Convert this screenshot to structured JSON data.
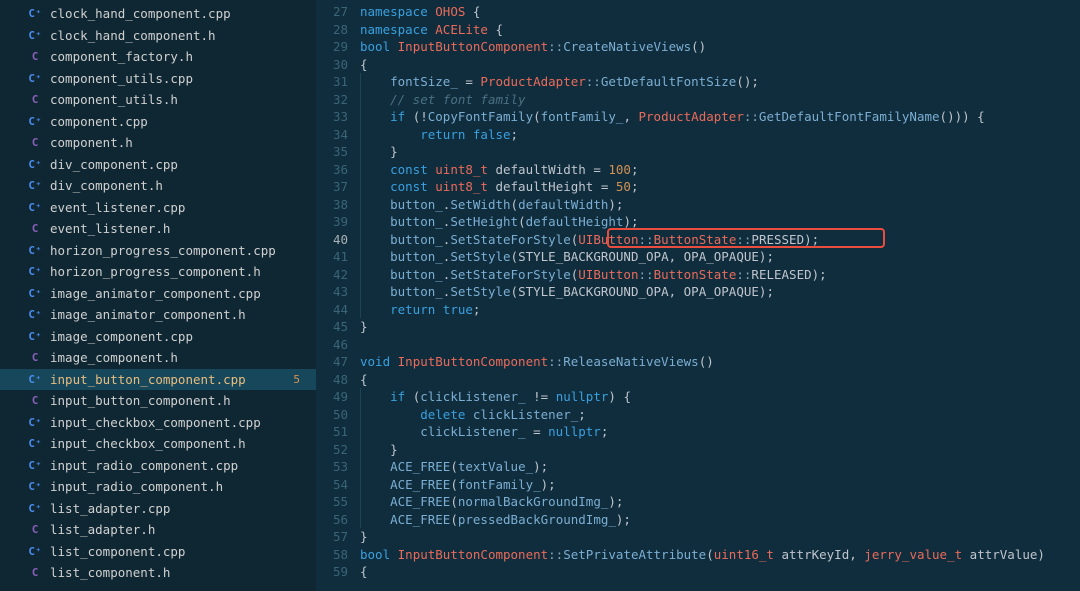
{
  "sidebar": {
    "files": [
      {
        "name": "clock_hand_component.cpp",
        "icon": "cpp"
      },
      {
        "name": "clock_hand_component.h",
        "icon": "cpp"
      },
      {
        "name": "component_factory.h",
        "icon": "h"
      },
      {
        "name": "component_utils.cpp",
        "icon": "cpp"
      },
      {
        "name": "component_utils.h",
        "icon": "h"
      },
      {
        "name": "component.cpp",
        "icon": "cpp"
      },
      {
        "name": "component.h",
        "icon": "h"
      },
      {
        "name": "div_component.cpp",
        "icon": "cpp"
      },
      {
        "name": "div_component.h",
        "icon": "cpp"
      },
      {
        "name": "event_listener.cpp",
        "icon": "cpp"
      },
      {
        "name": "event_listener.h",
        "icon": "h"
      },
      {
        "name": "horizon_progress_component.cpp",
        "icon": "cpp"
      },
      {
        "name": "horizon_progress_component.h",
        "icon": "cpp"
      },
      {
        "name": "image_animator_component.cpp",
        "icon": "cpp"
      },
      {
        "name": "image_animator_component.h",
        "icon": "cpp"
      },
      {
        "name": "image_component.cpp",
        "icon": "cpp"
      },
      {
        "name": "image_component.h",
        "icon": "h"
      },
      {
        "name": "input_button_component.cpp",
        "icon": "cpp",
        "active": true,
        "badge": "5"
      },
      {
        "name": "input_button_component.h",
        "icon": "h"
      },
      {
        "name": "input_checkbox_component.cpp",
        "icon": "cpp"
      },
      {
        "name": "input_checkbox_component.h",
        "icon": "cpp"
      },
      {
        "name": "input_radio_component.cpp",
        "icon": "cpp"
      },
      {
        "name": "input_radio_component.h",
        "icon": "cpp"
      },
      {
        "name": "list_adapter.cpp",
        "icon": "cpp"
      },
      {
        "name": "list_adapter.h",
        "icon": "h"
      },
      {
        "name": "list_component.cpp",
        "icon": "cpp"
      },
      {
        "name": "list_component.h",
        "icon": "h"
      }
    ]
  },
  "editor": {
    "startLine": 27,
    "currentLine": 40,
    "highlight": {
      "line": 40,
      "startCol": 27,
      "endCol": 59
    },
    "lines": [
      {
        "n": 27,
        "seg": [
          [
            "kw",
            "namespace "
          ],
          [
            "cls",
            "OHOS"
          ],
          [
            "plain",
            " {"
          ]
        ]
      },
      {
        "n": 28,
        "seg": [
          [
            "kw",
            "namespace "
          ],
          [
            "cls",
            "ACELite"
          ],
          [
            "plain",
            " {"
          ]
        ]
      },
      {
        "n": 29,
        "seg": [
          [
            "kw",
            "bool "
          ],
          [
            "cls",
            "InputButtonComponent"
          ],
          [
            "op",
            "::"
          ],
          [
            "fn",
            "CreateNativeViews"
          ],
          [
            "plain",
            "()"
          ]
        ]
      },
      {
        "n": 30,
        "seg": [
          [
            "plain",
            "{"
          ]
        ]
      },
      {
        "n": 31,
        "seg": [
          [
            "plain",
            "    "
          ],
          [
            "id",
            "fontSize_"
          ],
          [
            "plain",
            " = "
          ],
          [
            "cls",
            "ProductAdapter"
          ],
          [
            "op",
            "::"
          ],
          [
            "fn",
            "GetDefaultFontSize"
          ],
          [
            "plain",
            "();"
          ]
        ]
      },
      {
        "n": 32,
        "seg": [
          [
            "plain",
            "    "
          ],
          [
            "cm",
            "// set font family"
          ]
        ]
      },
      {
        "n": 33,
        "seg": [
          [
            "plain",
            "    "
          ],
          [
            "kw",
            "if"
          ],
          [
            "plain",
            " (!"
          ],
          [
            "fn",
            "CopyFontFamily"
          ],
          [
            "plain",
            "("
          ],
          [
            "id",
            "fontFamily_"
          ],
          [
            "plain",
            ", "
          ],
          [
            "cls",
            "ProductAdapter"
          ],
          [
            "op",
            "::"
          ],
          [
            "fn",
            "GetDefaultFontFamilyName"
          ],
          [
            "plain",
            "())) {"
          ]
        ]
      },
      {
        "n": 34,
        "seg": [
          [
            "plain",
            "        "
          ],
          [
            "kwret",
            "return"
          ],
          [
            "plain",
            " "
          ],
          [
            "kw",
            "false"
          ],
          [
            "plain",
            ";"
          ]
        ]
      },
      {
        "n": 35,
        "seg": [
          [
            "plain",
            "    }"
          ]
        ]
      },
      {
        "n": 36,
        "seg": [
          [
            "plain",
            "    "
          ],
          [
            "kw",
            "const "
          ],
          [
            "type",
            "uint8_t"
          ],
          [
            "plain",
            " "
          ],
          [
            "const",
            "defaultWidth"
          ],
          [
            "plain",
            " = "
          ],
          [
            "num",
            "100"
          ],
          [
            "plain",
            ";"
          ]
        ]
      },
      {
        "n": 37,
        "seg": [
          [
            "plain",
            "    "
          ],
          [
            "kw",
            "const "
          ],
          [
            "type",
            "uint8_t"
          ],
          [
            "plain",
            " "
          ],
          [
            "const",
            "defaultHeight"
          ],
          [
            "plain",
            " = "
          ],
          [
            "num",
            "50"
          ],
          [
            "plain",
            ";"
          ]
        ]
      },
      {
        "n": 38,
        "seg": [
          [
            "plain",
            "    "
          ],
          [
            "id",
            "button_"
          ],
          [
            "plain",
            "."
          ],
          [
            "fn",
            "SetWidth"
          ],
          [
            "plain",
            "("
          ],
          [
            "id",
            "defaultWidth"
          ],
          [
            "plain",
            ");"
          ]
        ]
      },
      {
        "n": 39,
        "seg": [
          [
            "plain",
            "    "
          ],
          [
            "id",
            "button_"
          ],
          [
            "plain",
            "."
          ],
          [
            "fn",
            "SetHeight"
          ],
          [
            "plain",
            "("
          ],
          [
            "id",
            "defaultHeight"
          ],
          [
            "plain",
            ");"
          ]
        ]
      },
      {
        "n": 40,
        "seg": [
          [
            "plain",
            "    "
          ],
          [
            "id",
            "button_"
          ],
          [
            "plain",
            "."
          ],
          [
            "fn",
            "SetStateForStyle"
          ],
          [
            "plain",
            "("
          ],
          [
            "cls",
            "UIButton"
          ],
          [
            "op",
            "::"
          ],
          [
            "cls",
            "ButtonState"
          ],
          [
            "op",
            "::"
          ],
          [
            "const",
            "PRESSED"
          ],
          [
            "plain",
            ");"
          ]
        ]
      },
      {
        "n": 41,
        "seg": [
          [
            "plain",
            "    "
          ],
          [
            "id",
            "button_"
          ],
          [
            "plain",
            "."
          ],
          [
            "fn",
            "SetStyle"
          ],
          [
            "plain",
            "("
          ],
          [
            "const",
            "STYLE_BACKGROUND_OPA"
          ],
          [
            "plain",
            ", "
          ],
          [
            "const",
            "OPA_OPAQUE"
          ],
          [
            "plain",
            ");"
          ]
        ]
      },
      {
        "n": 42,
        "seg": [
          [
            "plain",
            "    "
          ],
          [
            "id",
            "button_"
          ],
          [
            "plain",
            "."
          ],
          [
            "fn",
            "SetStateForStyle"
          ],
          [
            "plain",
            "("
          ],
          [
            "cls",
            "UIButton"
          ],
          [
            "op",
            "::"
          ],
          [
            "cls",
            "ButtonState"
          ],
          [
            "op",
            "::"
          ],
          [
            "const",
            "RELEASED"
          ],
          [
            "plain",
            ");"
          ]
        ]
      },
      {
        "n": 43,
        "seg": [
          [
            "plain",
            "    "
          ],
          [
            "id",
            "button_"
          ],
          [
            "plain",
            "."
          ],
          [
            "fn",
            "SetStyle"
          ],
          [
            "plain",
            "("
          ],
          [
            "const",
            "STYLE_BACKGROUND_OPA"
          ],
          [
            "plain",
            ", "
          ],
          [
            "const",
            "OPA_OPAQUE"
          ],
          [
            "plain",
            ");"
          ]
        ]
      },
      {
        "n": 44,
        "seg": [
          [
            "plain",
            "    "
          ],
          [
            "kwret",
            "return"
          ],
          [
            "plain",
            " "
          ],
          [
            "kw",
            "true"
          ],
          [
            "plain",
            ";"
          ]
        ]
      },
      {
        "n": 45,
        "seg": [
          [
            "plain",
            "}"
          ]
        ]
      },
      {
        "n": 46,
        "seg": [
          [
            "plain",
            ""
          ]
        ]
      },
      {
        "n": 47,
        "seg": [
          [
            "kw",
            "void "
          ],
          [
            "cls",
            "InputButtonComponent"
          ],
          [
            "op",
            "::"
          ],
          [
            "fn",
            "ReleaseNativeViews"
          ],
          [
            "plain",
            "()"
          ]
        ]
      },
      {
        "n": 48,
        "seg": [
          [
            "plain",
            "{"
          ]
        ]
      },
      {
        "n": 49,
        "seg": [
          [
            "plain",
            "    "
          ],
          [
            "kw",
            "if"
          ],
          [
            "plain",
            " ("
          ],
          [
            "id",
            "clickListener_"
          ],
          [
            "plain",
            " != "
          ],
          [
            "kw",
            "nullptr"
          ],
          [
            "plain",
            ") {"
          ]
        ]
      },
      {
        "n": 50,
        "seg": [
          [
            "plain",
            "        "
          ],
          [
            "kw",
            "delete"
          ],
          [
            "plain",
            " "
          ],
          [
            "id",
            "clickListener_"
          ],
          [
            "plain",
            ";"
          ]
        ]
      },
      {
        "n": 51,
        "seg": [
          [
            "plain",
            "        "
          ],
          [
            "id",
            "clickListener_"
          ],
          [
            "plain",
            " = "
          ],
          [
            "kw",
            "nullptr"
          ],
          [
            "plain",
            ";"
          ]
        ]
      },
      {
        "n": 52,
        "seg": [
          [
            "plain",
            "    }"
          ]
        ]
      },
      {
        "n": 53,
        "seg": [
          [
            "plain",
            "    "
          ],
          [
            "macro",
            "ACE_FREE"
          ],
          [
            "plain",
            "("
          ],
          [
            "id",
            "textValue_"
          ],
          [
            "plain",
            ");"
          ]
        ]
      },
      {
        "n": 54,
        "seg": [
          [
            "plain",
            "    "
          ],
          [
            "macro",
            "ACE_FREE"
          ],
          [
            "plain",
            "("
          ],
          [
            "id",
            "fontFamily_"
          ],
          [
            "plain",
            ");"
          ]
        ]
      },
      {
        "n": 55,
        "seg": [
          [
            "plain",
            "    "
          ],
          [
            "macro",
            "ACE_FREE"
          ],
          [
            "plain",
            "("
          ],
          [
            "id",
            "normalBackGroundImg_"
          ],
          [
            "plain",
            ");"
          ]
        ]
      },
      {
        "n": 56,
        "seg": [
          [
            "plain",
            "    "
          ],
          [
            "macro",
            "ACE_FREE"
          ],
          [
            "plain",
            "("
          ],
          [
            "id",
            "pressedBackGroundImg_"
          ],
          [
            "plain",
            ");"
          ]
        ]
      },
      {
        "n": 57,
        "seg": [
          [
            "plain",
            "}"
          ]
        ]
      },
      {
        "n": 58,
        "seg": [
          [
            "kw",
            "bool "
          ],
          [
            "cls",
            "InputButtonComponent"
          ],
          [
            "op",
            "::"
          ],
          [
            "fn",
            "SetPrivateAttribute"
          ],
          [
            "plain",
            "("
          ],
          [
            "type",
            "uint16_t"
          ],
          [
            "plain",
            " "
          ],
          [
            "const",
            "attrKeyId"
          ],
          [
            "plain",
            ", "
          ],
          [
            "type",
            "jerry_value_t"
          ],
          [
            "plain",
            " "
          ],
          [
            "const",
            "attrValue"
          ],
          [
            "plain",
            ")"
          ]
        ]
      },
      {
        "n": 59,
        "seg": [
          [
            "plain",
            "{"
          ]
        ]
      }
    ]
  }
}
